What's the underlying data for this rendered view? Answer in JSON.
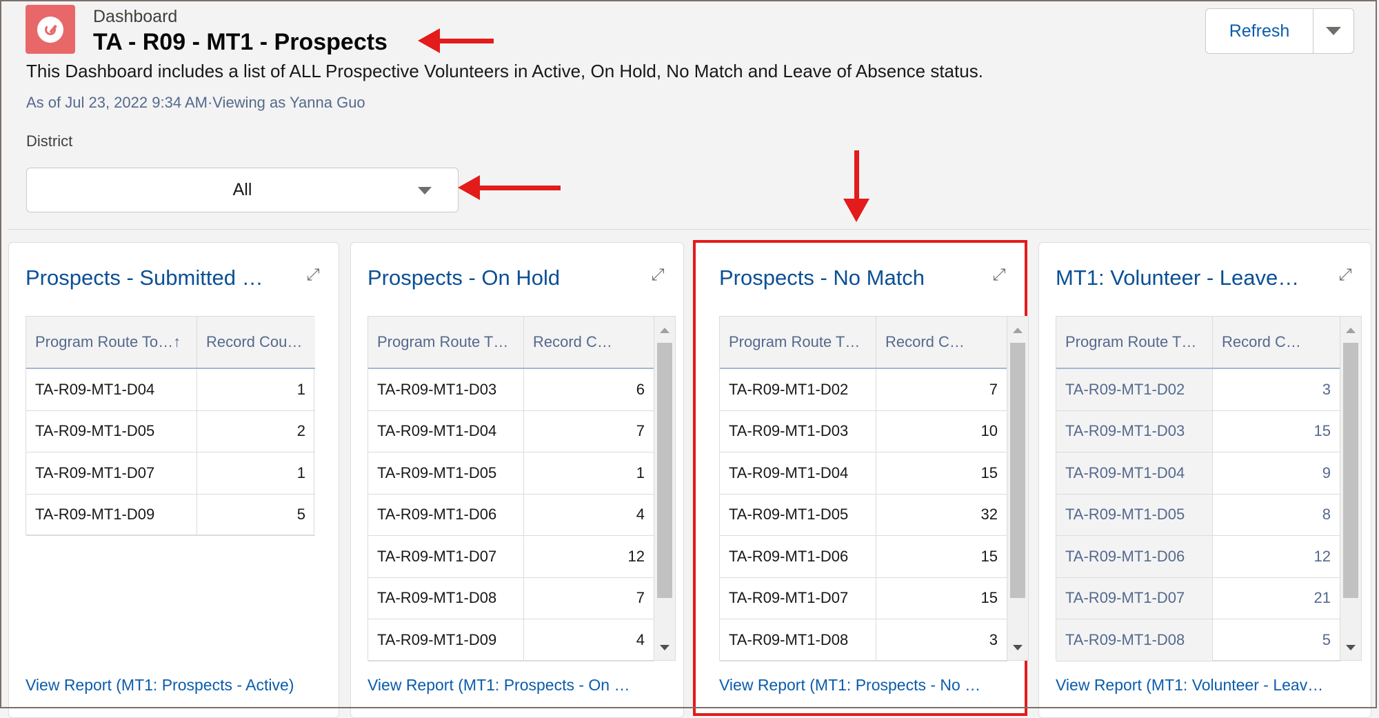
{
  "header": {
    "eyebrow": "Dashboard",
    "title": "TA - R09 - MT1 - Prospects",
    "description": "This Dashboard includes a list of ALL Prospective Volunteers in Active, On Hold, No Match and Leave of Absence status.",
    "as_of": "As of Jul 23, 2022 9:34 AM·Viewing as Yanna Guo",
    "filter_label": "District",
    "filter_value": "All",
    "refresh_label": "Refresh"
  },
  "colors": {
    "annotation": "#e31b1b",
    "link": "#0b5cab",
    "app_icon": "#e8686a"
  },
  "cards": [
    {
      "title": "Prospects - Submitted …",
      "col1": "Program Route To…↑",
      "col2": "Record Cou…",
      "rows": [
        {
          "route": "TA-R09-MT1-D04",
          "count": "1"
        },
        {
          "route": "TA-R09-MT1-D05",
          "count": "2"
        },
        {
          "route": "TA-R09-MT1-D07",
          "count": "1"
        },
        {
          "route": "TA-R09-MT1-D09",
          "count": "5"
        }
      ],
      "link": "View Report (MT1: Prospects - Active)"
    },
    {
      "title": "Prospects - On Hold",
      "col1": "Program Route T…",
      "col2": "Record C…",
      "rows": [
        {
          "route": "TA-R09-MT1-D03",
          "count": "6"
        },
        {
          "route": "TA-R09-MT1-D04",
          "count": "7"
        },
        {
          "route": "TA-R09-MT1-D05",
          "count": "1"
        },
        {
          "route": "TA-R09-MT1-D06",
          "count": "4"
        },
        {
          "route": "TA-R09-MT1-D07",
          "count": "12"
        },
        {
          "route": "TA-R09-MT1-D08",
          "count": "7"
        },
        {
          "route": "TA-R09-MT1-D09",
          "count": "4"
        }
      ],
      "link": "View Report (MT1: Prospects - On …"
    },
    {
      "title": "Prospects - No Match",
      "col1": "Program Route T…",
      "col2": "Record C…",
      "rows": [
        {
          "route": "TA-R09-MT1-D02",
          "count": "7"
        },
        {
          "route": "TA-R09-MT1-D03",
          "count": "10"
        },
        {
          "route": "TA-R09-MT1-D04",
          "count": "15"
        },
        {
          "route": "TA-R09-MT1-D05",
          "count": "32"
        },
        {
          "route": "TA-R09-MT1-D06",
          "count": "15"
        },
        {
          "route": "TA-R09-MT1-D07",
          "count": "15"
        },
        {
          "route": "TA-R09-MT1-D08",
          "count": "3"
        }
      ],
      "link": "View Report (MT1: Prospects - No …"
    },
    {
      "title": "MT1: Volunteer - Leave…",
      "col1": "Program Route T…",
      "col2": "Record C…",
      "rows": [
        {
          "route": "TA-R09-MT1-D02",
          "count": "3"
        },
        {
          "route": "TA-R09-MT1-D03",
          "count": "15"
        },
        {
          "route": "TA-R09-MT1-D04",
          "count": "9"
        },
        {
          "route": "TA-R09-MT1-D05",
          "count": "8"
        },
        {
          "route": "TA-R09-MT1-D06",
          "count": "12"
        },
        {
          "route": "TA-R09-MT1-D07",
          "count": "21"
        },
        {
          "route": "TA-R09-MT1-D08",
          "count": "5"
        }
      ],
      "link": "View Report (MT1: Volunteer - Leav…"
    }
  ]
}
